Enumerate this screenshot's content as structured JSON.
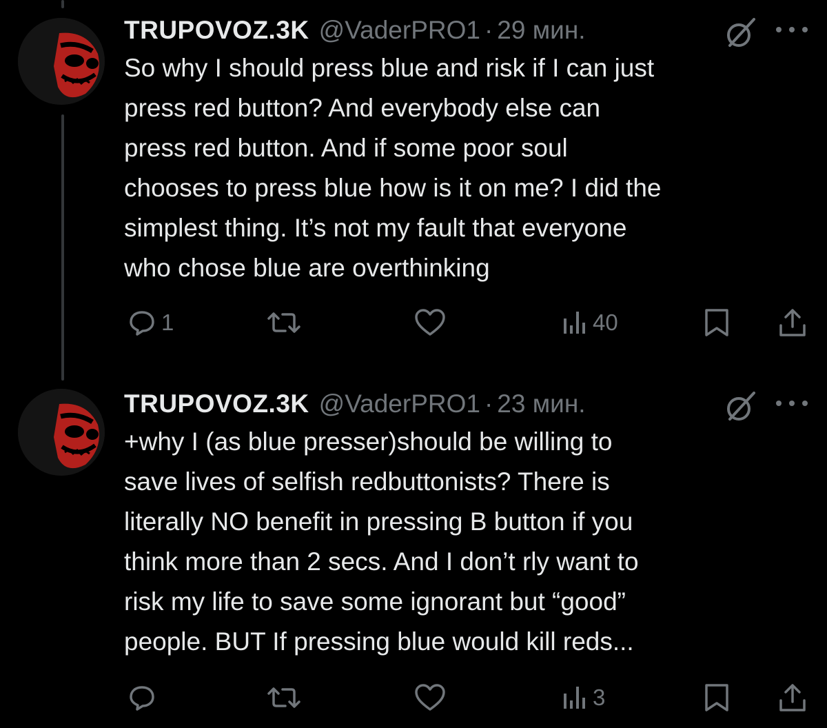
{
  "tweets": [
    {
      "display_name": "TRUPOVOZ.3K",
      "handle": "@VaderPRO1",
      "separator": "·",
      "time": "29 мин.",
      "text": "So why I should press blue and risk if I can just\npress red button? And everybody else can\npress red button. And if some poor soul\nchooses to press blue how is it on me? I did the\nsimplest thing. It’s not my fault that everyone\nwho chose blue are overthinking",
      "reply_count": "1",
      "retweet_count": "",
      "like_count": "",
      "view_count": "40"
    },
    {
      "display_name": "TRUPOVOZ.3K",
      "handle": "@VaderPRO1",
      "separator": "·",
      "time": "23 мин.",
      "text": "+why I (as blue presser)should be willing to\nsave lives of selfish redbuttonists? There is\nliterally NO benefit in pressing B button if you\nthink more than 2 secs. And I don’t rly want to\nrisk my life to save some ignorant but “good”\npeople. BUT If pressing blue would kill reds...",
      "reply_count": "",
      "retweet_count": "",
      "like_count": "",
      "view_count": "3"
    }
  ],
  "colors": {
    "background": "#000000",
    "text": "#e7e9ea",
    "secondary": "#71767b",
    "avatar_accent": "#b3201c"
  },
  "icons": {
    "reply": "reply-icon",
    "retweet": "retweet-icon",
    "like": "heart-icon",
    "views": "views-icon",
    "bookmark": "bookmark-icon",
    "share": "share-icon",
    "grok": "grok-icon",
    "more": "more-icon"
  }
}
